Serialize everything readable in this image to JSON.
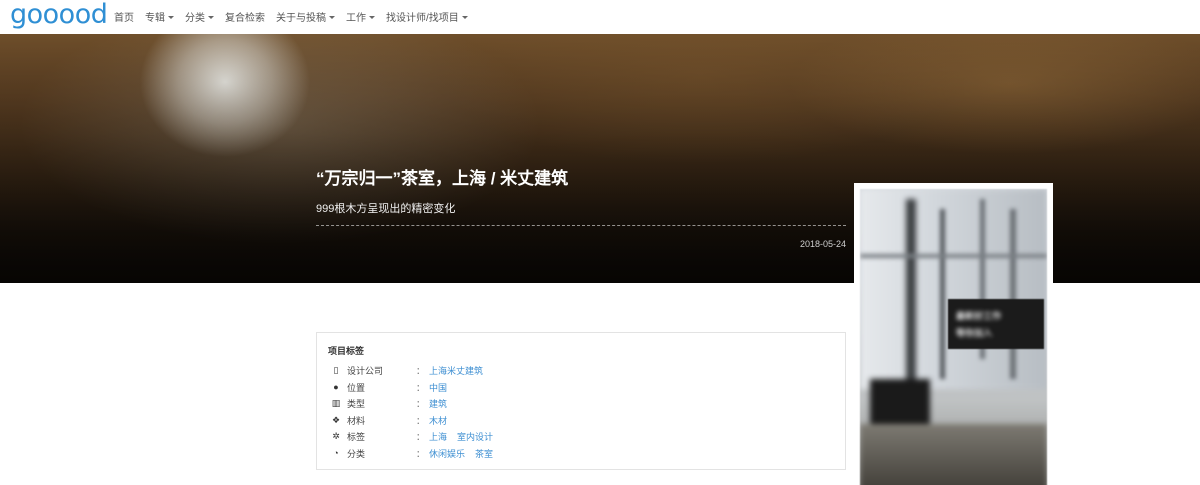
{
  "nav": {
    "logo": "gooood",
    "items": [
      {
        "label": "首页",
        "has_caret": false
      },
      {
        "label": "专辑",
        "has_caret": true
      },
      {
        "label": "分类",
        "has_caret": true
      },
      {
        "label": "复合检索",
        "has_caret": false
      },
      {
        "label": "关于与投稿",
        "has_caret": true
      },
      {
        "label": "工作",
        "has_caret": true
      },
      {
        "label": "找设计师/找项目",
        "has_caret": true
      }
    ]
  },
  "hero": {
    "title": "“万宗归一”茶室，上海 / 米丈建筑",
    "subtitle": "999根木方呈现出的精密变化",
    "date": "2018-05-24"
  },
  "tags_panel": {
    "title": "项目标签",
    "rows": [
      {
        "icon": "building-icon",
        "glyph": "▯",
        "label": "设计公司",
        "values": [
          "上海米丈建筑"
        ]
      },
      {
        "icon": "globe-icon",
        "glyph": "●",
        "label": "位置",
        "values": [
          "中国"
        ]
      },
      {
        "icon": "institution-icon",
        "glyph": "▥",
        "label": "类型",
        "values": [
          "建筑"
        ]
      },
      {
        "icon": "cubes-icon",
        "glyph": "❖",
        "label": "材料",
        "values": [
          "木材"
        ]
      },
      {
        "icon": "pinwheel-icon",
        "glyph": "✲",
        "label": "标签",
        "values": [
          "上海",
          "室内设计"
        ]
      },
      {
        "icon": "pie-chart-icon",
        "glyph": "◔",
        "label": "分类",
        "values": [
          "休闲娱乐",
          "茶室"
        ]
      }
    ]
  },
  "ad": {
    "line1": "最新好工作",
    "line2": "等你加入"
  },
  "colors": {
    "accent": "#3e8fd2",
    "logo": "#2f8fd4"
  }
}
